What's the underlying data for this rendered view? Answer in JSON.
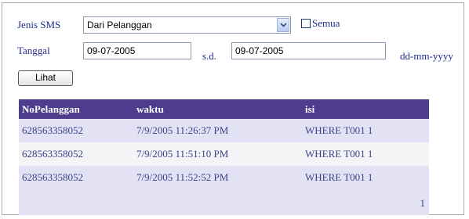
{
  "form": {
    "jenis_label": "Jenis SMS",
    "jenis_value": "Dari Pelanggan",
    "semua_label": "Semua",
    "tanggal_label": "Tanggal",
    "date_from": "09-07-2005",
    "sd_label": "s.d.",
    "date_to": "09-07-2005",
    "format_hint": "dd-mm-yyyy",
    "lihat_button": "Lihat"
  },
  "table": {
    "headers": [
      "NoPelanggan",
      "waktu",
      "isi"
    ],
    "rows": [
      [
        "628563358052",
        "7/9/2005 11:26:37 PM",
        "WHERE T001 1"
      ],
      [
        "628563358052",
        "7/9/2005 11:51:10 PM",
        "WHERE T001 1"
      ],
      [
        "628563358052",
        "7/9/2005 11:52:52 PM",
        "WHERE T001 1"
      ]
    ],
    "page": "1"
  },
  "colors": {
    "header_bg": "#4e3d8c",
    "row_odd": "#e2e2f4",
    "row_even": "#f4f4f6",
    "text": "#1e2a8a"
  }
}
